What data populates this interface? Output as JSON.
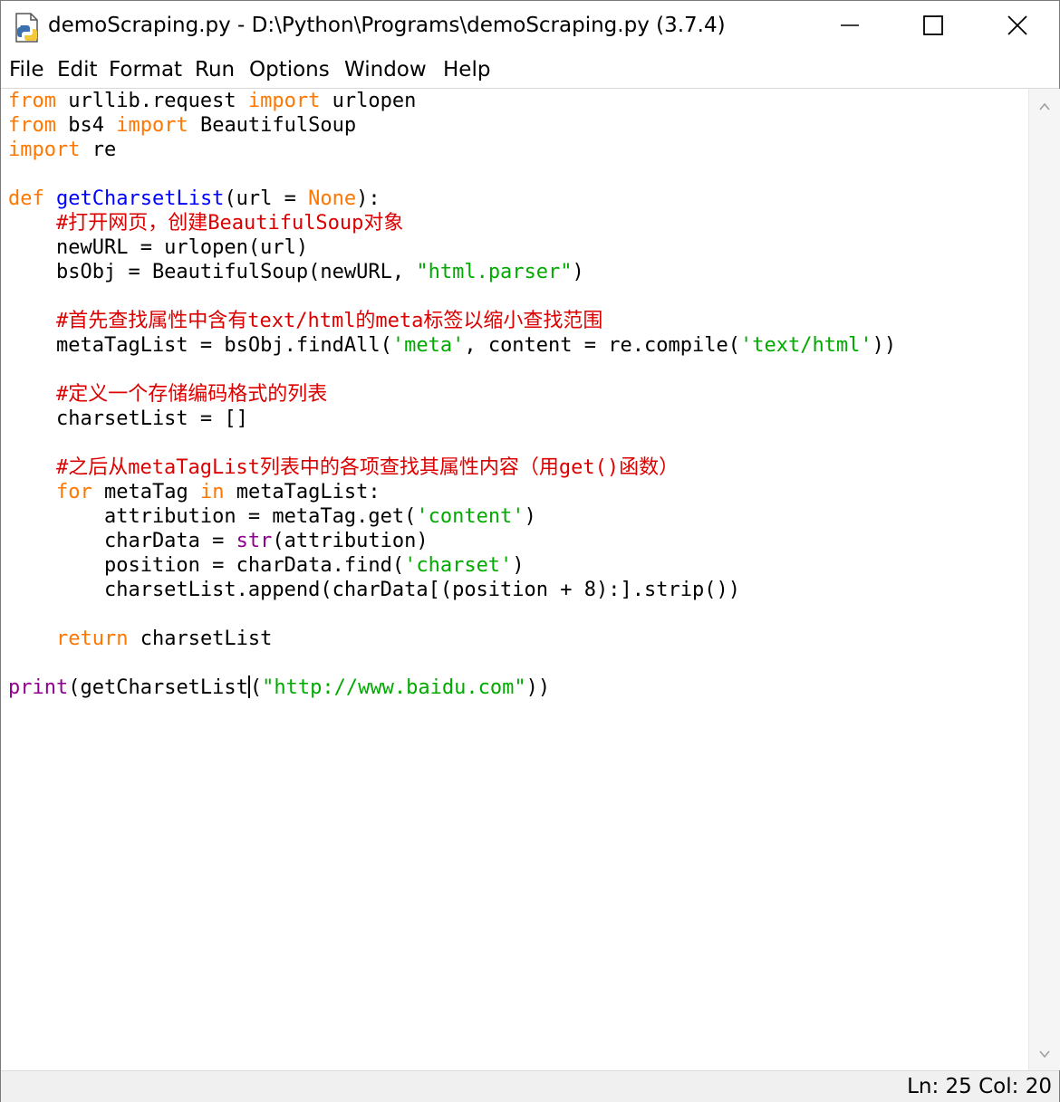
{
  "window": {
    "title": "demoScraping.py - D:\\Python\\Programs\\demoScraping.py (3.7.4)",
    "icon": "python-file-icon",
    "controls": [
      "minimize-icon",
      "maximize-icon",
      "close-icon"
    ]
  },
  "menu": [
    "File",
    "Edit",
    "Format",
    "Run",
    "Options",
    "Window",
    "Help"
  ],
  "syntax_colors": {
    "keyword": "#ff7700",
    "builtin": "#900090",
    "string": "#00aa00",
    "comment": "#dd0000",
    "definition": "#0000ff"
  },
  "code": {
    "lines": [
      [
        {
          "t": "kw",
          "s": "from"
        },
        {
          "t": "",
          "s": " urllib.request "
        },
        {
          "t": "kw",
          "s": "import"
        },
        {
          "t": "",
          "s": " urlopen"
        }
      ],
      [
        {
          "t": "kw",
          "s": "from"
        },
        {
          "t": "",
          "s": " bs4 "
        },
        {
          "t": "kw",
          "s": "import"
        },
        {
          "t": "",
          "s": " BeautifulSoup"
        }
      ],
      [
        {
          "t": "kw",
          "s": "import"
        },
        {
          "t": "",
          "s": " re"
        }
      ],
      [],
      [
        {
          "t": "kw",
          "s": "def"
        },
        {
          "t": "",
          "s": " "
        },
        {
          "t": "fn",
          "s": "getCharsetList"
        },
        {
          "t": "",
          "s": "(url = "
        },
        {
          "t": "kw",
          "s": "None"
        },
        {
          "t": "",
          "s": "):"
        }
      ],
      [
        {
          "t": "",
          "s": "    "
        },
        {
          "t": "cm",
          "s": "#打开网页，创建BeautifulSoup对象"
        }
      ],
      [
        {
          "t": "",
          "s": "    newURL = urlopen(url)"
        }
      ],
      [
        {
          "t": "",
          "s": "    bsObj = BeautifulSoup(newURL, "
        },
        {
          "t": "str",
          "s": "\"html.parser\""
        },
        {
          "t": "",
          "s": ")"
        }
      ],
      [],
      [
        {
          "t": "",
          "s": "    "
        },
        {
          "t": "cm",
          "s": "#首先查找属性中含有text/html的meta标签以缩小查找范围"
        }
      ],
      [
        {
          "t": "",
          "s": "    metaTagList = bsObj.findAll("
        },
        {
          "t": "str",
          "s": "'meta'"
        },
        {
          "t": "",
          "s": ", content = re.compile("
        },
        {
          "t": "str",
          "s": "'text/html'"
        },
        {
          "t": "",
          "s": "))"
        }
      ],
      [],
      [
        {
          "t": "",
          "s": "    "
        },
        {
          "t": "cm",
          "s": "#定义一个存储编码格式的列表"
        }
      ],
      [
        {
          "t": "",
          "s": "    charsetList = []"
        }
      ],
      [],
      [
        {
          "t": "",
          "s": "    "
        },
        {
          "t": "cm",
          "s": "#之后从metaTagList列表中的各项查找其属性内容（用get()函数）"
        }
      ],
      [
        {
          "t": "",
          "s": "    "
        },
        {
          "t": "kw",
          "s": "for"
        },
        {
          "t": "",
          "s": " metaTag "
        },
        {
          "t": "kw",
          "s": "in"
        },
        {
          "t": "",
          "s": " metaTagList:"
        }
      ],
      [
        {
          "t": "",
          "s": "        attribution = metaTag.get("
        },
        {
          "t": "str",
          "s": "'content'"
        },
        {
          "t": "",
          "s": ")"
        }
      ],
      [
        {
          "t": "",
          "s": "        charData = "
        },
        {
          "t": "bi",
          "s": "str"
        },
        {
          "t": "",
          "s": "(attribution)"
        }
      ],
      [
        {
          "t": "",
          "s": "        position = charData.find("
        },
        {
          "t": "str",
          "s": "'charset'"
        },
        {
          "t": "",
          "s": ")"
        }
      ],
      [
        {
          "t": "",
          "s": "        charsetList.append(charData[(position + 8):].strip())"
        }
      ],
      [],
      [
        {
          "t": "",
          "s": "    "
        },
        {
          "t": "kw",
          "s": "return"
        },
        {
          "t": "",
          "s": " charsetList"
        }
      ],
      [],
      [
        {
          "t": "bi",
          "s": "print"
        },
        {
          "t": "",
          "s": "(getCharsetList"
        },
        {
          "t": "caret",
          "s": ""
        },
        {
          "t": "",
          "s": "("
        },
        {
          "t": "str",
          "s": "\"http://www.baidu.com\""
        },
        {
          "t": "",
          "s": "))"
        }
      ]
    ]
  },
  "status": {
    "ln_label": "Ln:",
    "ln_value": "25",
    "col_label": "Col:",
    "col_value": "20"
  }
}
